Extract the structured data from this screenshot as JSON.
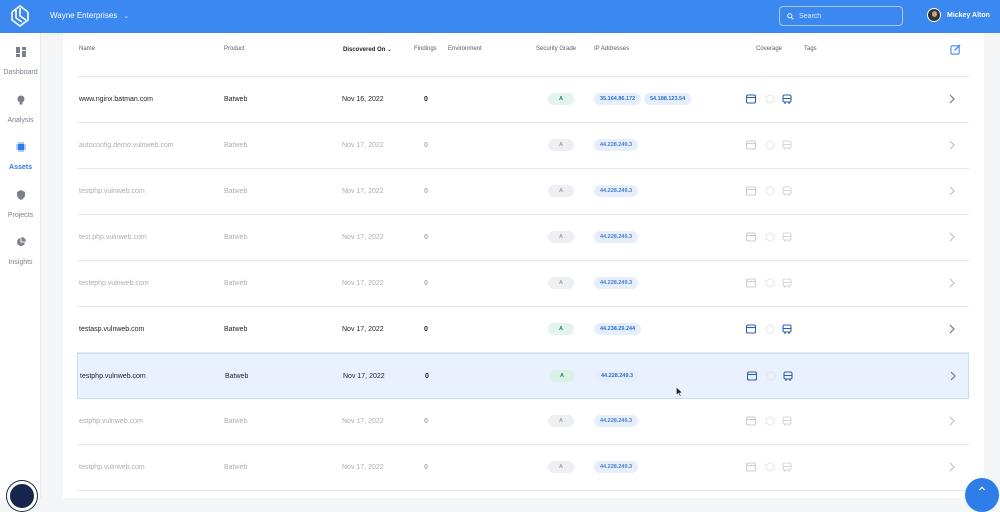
{
  "topbar": {
    "org_name": "Wayne Enterprises",
    "search_placeholder": "Search",
    "user_name": "Mickey Alton",
    "accent": "#3a88f0"
  },
  "sidebar": {
    "items": [
      {
        "label": "Dashboard",
        "icon": "dashboard-icon",
        "active": false
      },
      {
        "label": "Analysis",
        "icon": "bulb-icon",
        "active": false
      },
      {
        "label": "Assets",
        "icon": "chip-icon",
        "active": true
      },
      {
        "label": "Projects",
        "icon": "shield-icon",
        "active": false
      },
      {
        "label": "Insights",
        "icon": "pie-chart-icon",
        "active": false
      }
    ]
  },
  "table": {
    "headers": {
      "name": "Name",
      "product": "Product",
      "discovered": "Discovered On",
      "findings": "Findings",
      "environment": "Environment",
      "grade": "Security Grade",
      "ips": "IP Addresses",
      "coverage": "Coverage",
      "tags": "Tags"
    },
    "rows": [
      {
        "name": "www.nginx.batman.com",
        "product": "Batweb",
        "date": "Nov 16, 2022",
        "findings": "0",
        "grade": "A",
        "ips": [
          "35.164.86.172",
          "54.188.123.54"
        ],
        "dim": false
      },
      {
        "name": "autoconfig.demo.vulnweb.com",
        "product": "Batweb",
        "date": "Nov 17, 2022",
        "findings": "0",
        "grade": "A",
        "ips": [
          "44.228.249.3"
        ],
        "dim": true
      },
      {
        "name": "testphp.vulnweb.com",
        "product": "Batweb",
        "date": "Nov 17, 2022",
        "findings": "0",
        "grade": "A",
        "ips": [
          "44.228.249.3"
        ],
        "dim": true
      },
      {
        "name": "test.php.vulnweb.com",
        "product": "Batweb",
        "date": "Nov 17, 2022",
        "findings": "0",
        "grade": "A",
        "ips": [
          "44.228.249.3"
        ],
        "dim": true
      },
      {
        "name": "testephp.vulnweb.com",
        "product": "Batweb",
        "date": "Nov 17, 2022",
        "findings": "0",
        "grade": "A",
        "ips": [
          "44.228.249.3"
        ],
        "dim": true
      },
      {
        "name": "testasp.vulnweb.com",
        "product": "Batweb",
        "date": "Nov 17, 2022",
        "findings": "0",
        "grade": "A",
        "ips": [
          "44.238.29.244"
        ],
        "dim": false
      },
      {
        "name": "testphp.vulnweb.com",
        "product": "Batweb",
        "date": "Nov 17, 2022",
        "findings": "0",
        "grade": "A",
        "ips": [
          "44.228.249.3"
        ],
        "dim": false,
        "hl": true
      },
      {
        "name": "estphp.vulnweb.com",
        "product": "Batweb",
        "date": "Nov 17, 2022",
        "findings": "0",
        "grade": "A",
        "ips": [
          "44.228.249.3"
        ],
        "dim": true
      },
      {
        "name": "testphp.vulnweb.com",
        "product": "Batweb",
        "date": "Nov 17, 2022",
        "findings": "0",
        "grade": "A",
        "ips": [
          "44.228.249.3"
        ],
        "dim": true
      }
    ]
  }
}
